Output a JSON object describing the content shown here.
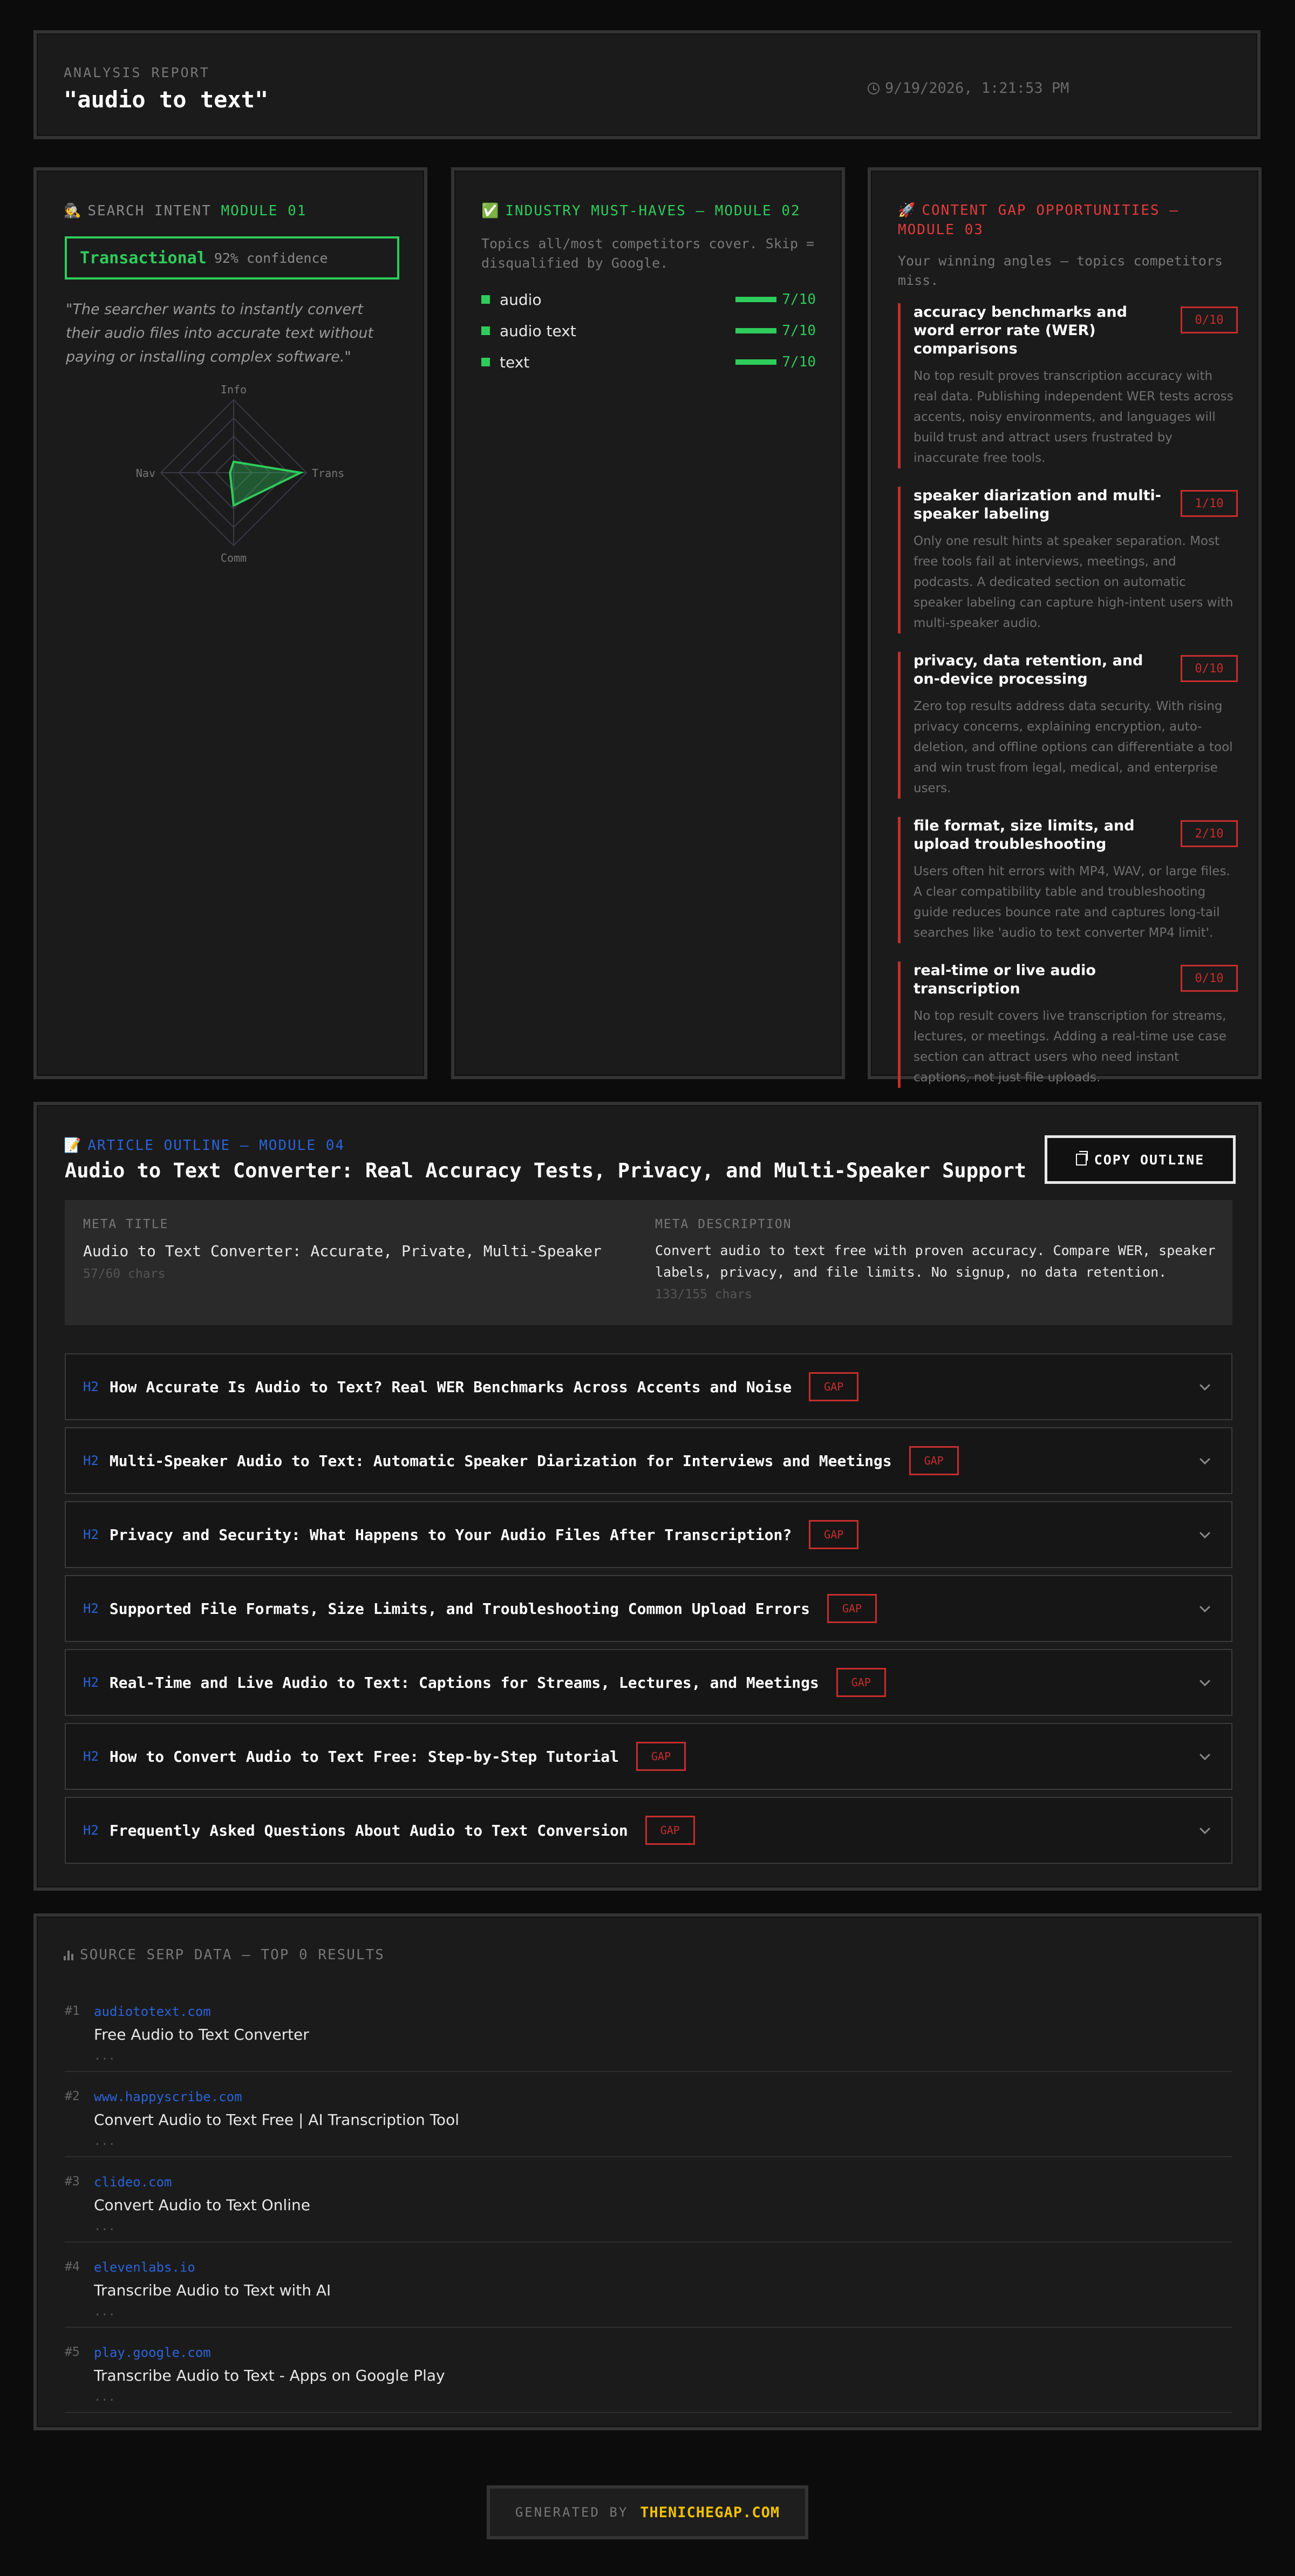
{
  "header": {
    "eyebrow": "ANALYSIS REPORT",
    "title": "\"audio to text\"",
    "timestamp": "9/19/2026, 1:21:53 PM"
  },
  "module1": {
    "emoji": "🕵️",
    "label": "SEARCH INTENT",
    "number": "MODULE 01",
    "intent_type": "Transactional",
    "confidence": "92% confidence",
    "quote": "\"The searcher wants to instantly convert their audio files into accurate text without paying or installing complex software.\"",
    "radar": {
      "axes": [
        "Info",
        "Trans",
        "Comm",
        "Nav"
      ],
      "values": [
        0.15,
        0.92,
        0.45,
        0.05
      ],
      "color": "#2ecc5b"
    }
  },
  "module2": {
    "emoji": "✅",
    "heading": "INDUSTRY MUST-HAVES — MODULE 02",
    "subtitle": "Topics all/most competitors cover. Skip = disqualified by Google.",
    "items": [
      {
        "term": "audio",
        "score": "7/10"
      },
      {
        "term": "audio text",
        "score": "7/10"
      },
      {
        "term": "text",
        "score": "7/10"
      }
    ]
  },
  "module3": {
    "emoji": "🚀",
    "heading": "CONTENT GAP OPPORTUNITIES — MODULE 03",
    "subtitle": "Your winning angles — topics competitors miss.",
    "gaps": [
      {
        "title": "accuracy benchmarks and word error rate (WER) comparisons",
        "score": "0/10",
        "desc": "No top result proves transcription accuracy with real data. Publishing independent WER tests across accents, noisy environments, and languages will build trust and attract users frustrated by inaccurate free tools."
      },
      {
        "title": "speaker diarization and multi-speaker labeling",
        "score": "1/10",
        "desc": "Only one result hints at speaker separation. Most free tools fail at interviews, meetings, and podcasts. A dedicated section on automatic speaker labeling can capture high-intent users with multi-speaker audio."
      },
      {
        "title": "privacy, data retention, and on-device processing",
        "score": "0/10",
        "desc": "Zero top results address data security. With rising privacy concerns, explaining encryption, auto-deletion, and offline options can differentiate a tool and win trust from legal, medical, and enterprise users."
      },
      {
        "title": "file format, size limits, and upload troubleshooting",
        "score": "2/10",
        "desc": "Users often hit errors with MP4, WAV, or large files. A clear compatibility table and troubleshooting guide reduces bounce rate and captures long-tail searches like 'audio to text converter MP4 limit'."
      },
      {
        "title": "real-time or live audio transcription",
        "score": "0/10",
        "desc": "No top result covers live transcription for streams, lectures, or meetings. Adding a real-time use case section can attract users who need instant captions, not just file uploads."
      }
    ]
  },
  "outline": {
    "emoji": "📝",
    "heading": "ARTICLE OUTLINE — MODULE 04",
    "title": "Audio to Text Converter: Real Accuracy Tests, Privacy, and Multi-Speaker Support",
    "copy_label": "COPY OUTLINE",
    "meta_title_label": "META TITLE",
    "meta_title": "Audio to Text Converter: Accurate, Private, Multi-Speaker",
    "meta_title_count": "57/60 chars",
    "meta_desc_label": "META DESCRIPTION",
    "meta_desc": "Convert audio to text free with proven accuracy. Compare WER, speaker labels, privacy, and file limits. No signup, no data retention.",
    "meta_desc_count": "133/155 chars",
    "h2_tag": "H2",
    "gap_badge": "GAP",
    "sections": [
      "How Accurate Is Audio to Text? Real WER Benchmarks Across Accents and Noise",
      "Multi-Speaker Audio to Text: Automatic Speaker Diarization for Interviews and Meetings",
      "Privacy and Security: What Happens to Your Audio Files After Transcription?",
      "Supported File Formats, Size Limits, and Troubleshooting Common Upload Errors",
      "Real-Time and Live Audio to Text: Captions for Streams, Lectures, and Meetings",
      "How to Convert Audio to Text Free: Step-by-Step Tutorial",
      "Frequently Asked Questions About Audio to Text Conversion"
    ]
  },
  "serp": {
    "heading": "SOURCE SERP DATA — TOP 0 RESULTS",
    "results": [
      {
        "rank": "#1",
        "domain": "audiototext.com",
        "title": "Free Audio to Text Converter",
        "snippet": "..."
      },
      {
        "rank": "#2",
        "domain": "www.happyscribe.com",
        "title": "Convert Audio to Text Free | AI Transcription Tool",
        "snippet": "..."
      },
      {
        "rank": "#3",
        "domain": "clideo.com",
        "title": "Convert Audio to Text Online",
        "snippet": "..."
      },
      {
        "rank": "#4",
        "domain": "elevenlabs.io",
        "title": "Transcribe Audio to Text with AI",
        "snippet": "..."
      },
      {
        "rank": "#5",
        "domain": "play.google.com",
        "title": "Transcribe Audio to Text - Apps on Google Play",
        "snippet": "..."
      }
    ]
  },
  "footer": {
    "generated": "GENERATED BY",
    "brand": "THENICHEGAP.COM"
  },
  "colors": {
    "accent_green": "#2ecc5b",
    "accent_red": "#c62d2d",
    "accent_blue": "#2b63d8",
    "brand_yellow": "#f2c200"
  }
}
